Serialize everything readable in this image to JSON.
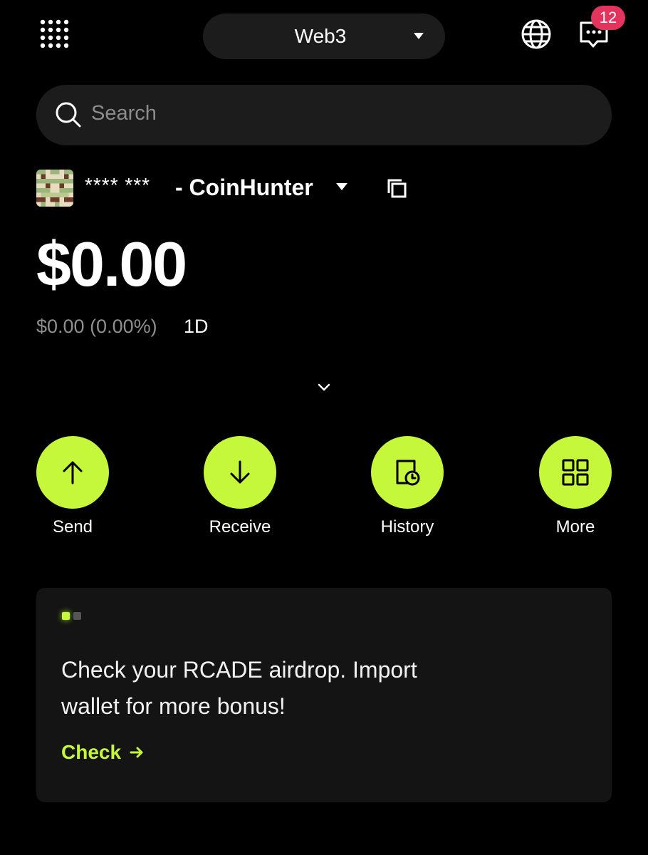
{
  "header": {
    "network_label": "Web3",
    "notifications_count": "12",
    "icons": [
      "apps-grid-icon",
      "caret-down-icon",
      "globe-icon",
      "message-icon"
    ]
  },
  "search": {
    "placeholder": "Search",
    "icon": "search-icon"
  },
  "account": {
    "masked_id": "**** ***",
    "name": "- CoinHunter",
    "avatar": "pixel-avatar",
    "icons": [
      "caret-down-icon",
      "copy-icon"
    ]
  },
  "balance": {
    "total": "$0.00",
    "change": "$0.00 (0.00%)",
    "period": "1D"
  },
  "actions": [
    {
      "label": "Send",
      "icon": "arrow-up-icon"
    },
    {
      "label": "Receive",
      "icon": "arrow-down-icon"
    },
    {
      "label": "History",
      "icon": "history-icon"
    },
    {
      "label": "More",
      "icon": "grid-icon"
    }
  ],
  "promo": {
    "text": "Check your RCADE airdrop. Import wallet for more bonus!",
    "link_label": "Check",
    "page_indicator": {
      "current": 1,
      "total": 2
    }
  },
  "colors": {
    "background": "#000000",
    "surface": "#1c1c1c",
    "card": "#141414",
    "accent": "#c5f73a",
    "badge": "#e2345c",
    "muted_text": "#8f8f8f"
  }
}
